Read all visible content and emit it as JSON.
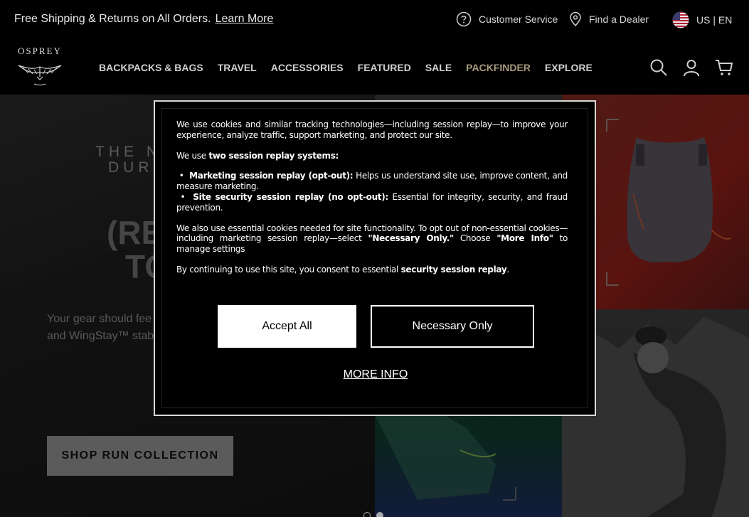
{
  "promo": {
    "text": "Free Shipping & Returns on All Orders.",
    "link": "Learn More"
  },
  "utility": {
    "customer_service": "Customer Service",
    "find_dealer": "Find a Dealer",
    "locale": "US | EN"
  },
  "brand": {
    "logo_text": "OSPREY"
  },
  "nav": {
    "items": [
      {
        "label": "BACKPACKS & BAGS"
      },
      {
        "label": "TRAVEL"
      },
      {
        "label": "ACCESSORIES"
      },
      {
        "label": "FEATURED"
      },
      {
        "label": "SALE"
      },
      {
        "label": "PACKFINDER"
      },
      {
        "label": "EXPLORE"
      }
    ]
  },
  "hero": {
    "eyebrow_line1": "THE N",
    "eyebrow_line2": "DURO",
    "title_line1": "(RE",
    "title_line2": "TO",
    "body": "Your gear should fee to the finish line. Th stride with lighter, so and WingStay™ stab carry.",
    "cta": "SHOP RUN COLLECTION"
  },
  "cookie_modal": {
    "intro": "We use cookies and similar tracking technologies—including session replay—to improve your experience, analyze traffic, support marketing, and protect our site.",
    "systems_prefix": "We use ",
    "systems_bold": "two session replay systems:",
    "bullet1_bold": "Marketing session replay (opt-out):",
    "bullet1_text": " Helps us understand site use, improve content, and measure marketing.",
    "bullet2_bold": "Site security session replay (no opt-out):",
    "bullet2_text": " Essential for integrity, security, and fraud prevention.",
    "essential_part1": "We also use essential cookies needed for site functionality. To opt out of non-essential cookies—including marketing session replay—select ",
    "essential_bold1": "\"Necessary Only.\"",
    "essential_part2": " Choose ",
    "essential_bold2": "\"More Info\"",
    "essential_part3": " to manage settings",
    "consent_part1": "By continuing to use this site, you consent to essential ",
    "consent_bold": "security session replay",
    "consent_part2": ".",
    "accept_label": "Accept All",
    "necessary_label": "Necessary Only",
    "more_info_label": "MORE INFO"
  },
  "colors": {
    "packfinder": "#a69a7e",
    "nav_text": "#cfcfcf",
    "modal_bg": "#000000"
  }
}
